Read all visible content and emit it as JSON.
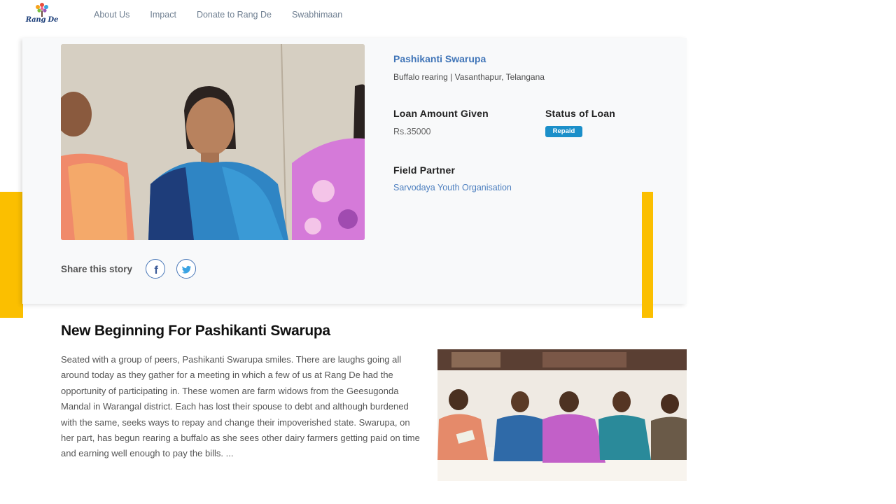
{
  "brand": {
    "logo_text": "Rang De"
  },
  "nav": {
    "items": [
      "About Us",
      "Impact",
      "Donate to Rang De",
      "Swabhimaan"
    ]
  },
  "borrower": {
    "name": "Pashikanti Swarupa",
    "subtitle": "Buffalo rearing | Vasanthapur, Telangana",
    "loan_amount_label": "Loan Amount Given",
    "loan_amount_value": "Rs.35000",
    "status_label": "Status of Loan",
    "status_value": "Repaid",
    "partner_label": "Field Partner",
    "partner_value": "Sarvodaya Youth Organisation"
  },
  "share": {
    "label": "Share this story",
    "icons": [
      "facebook-icon",
      "twitter-icon"
    ]
  },
  "story": {
    "title": "New Beginning For Pashikanti Swarupa",
    "body": "Seated with a group of peers, Pashikanti Swarupa smiles. There are laughs going all around today as they gather for a meeting in which a few of us at Rang De had the opportunity of participating in. These women are farm widows from the Geesugonda Mandal in Warangal district. Each has lost their spouse to debt and although burdened with the same, seeks ways to repay and change their impoverished state. Swarupa, on her part, has begun rearing a buffalo as she sees other dairy farmers getting paid on time and earning well enough to pay the bills. ..."
  },
  "colors": {
    "accent_yellow": "#fbbf00",
    "link_blue": "#3f74b7",
    "badge_blue": "#1b8fc9"
  }
}
